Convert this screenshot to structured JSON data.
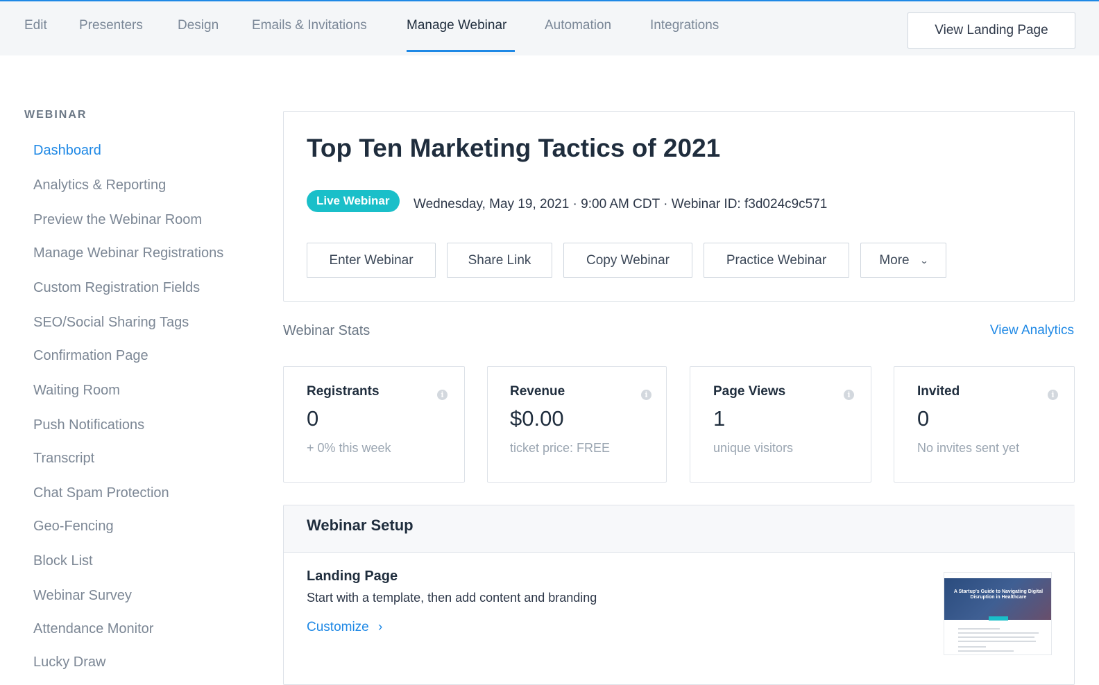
{
  "topnav": {
    "tabs": [
      {
        "label": "Edit"
      },
      {
        "label": "Presenters"
      },
      {
        "label": "Design"
      },
      {
        "label": "Emails & Invitations"
      },
      {
        "label": "Manage Webinar",
        "active": true
      },
      {
        "label": "Automation"
      },
      {
        "label": "Integrations"
      }
    ],
    "view_landing_label": "View Landing Page"
  },
  "sidebar": {
    "heading": "WEBINAR",
    "items": [
      {
        "label": "Dashboard",
        "active": true
      },
      {
        "label": "Analytics & Reporting"
      },
      {
        "label": "Preview the Webinar Room"
      },
      {
        "label": "Manage Webinar Registrations"
      },
      {
        "label": "Custom Registration Fields"
      },
      {
        "label": "SEO/Social Sharing Tags"
      },
      {
        "label": "Confirmation Page"
      },
      {
        "label": "Waiting Room"
      },
      {
        "label": "Push Notifications"
      },
      {
        "label": "Transcript"
      },
      {
        "label": "Chat Spam Protection"
      },
      {
        "label": "Geo-Fencing"
      },
      {
        "label": "Block List"
      },
      {
        "label": "Webinar Survey"
      },
      {
        "label": "Attendance Monitor"
      },
      {
        "label": "Lucky Draw"
      }
    ]
  },
  "webinar": {
    "title": "Top Ten Marketing Tactics of 2021",
    "badge": "Live Webinar",
    "meta": "Wednesday, May 19, 2021 · 9:00 AM CDT · Webinar ID: f3d024c9c571",
    "actions": {
      "enter": "Enter Webinar",
      "share": "Share Link",
      "copy": "Copy Webinar",
      "practice": "Practice Webinar",
      "more": "More"
    }
  },
  "stats": {
    "section_title": "Webinar Stats",
    "view_analytics": "View Analytics",
    "cards": [
      {
        "label": "Registrants",
        "value": "0",
        "sub": "+ 0% this week"
      },
      {
        "label": "Revenue",
        "value": "$0.00",
        "sub": "ticket price: FREE"
      },
      {
        "label": "Page Views",
        "value": "1",
        "sub": "unique visitors"
      },
      {
        "label": "Invited",
        "value": "0",
        "sub": "No invites sent yet"
      }
    ]
  },
  "setup": {
    "title": "Webinar Setup",
    "landing": {
      "title": "Landing Page",
      "desc": "Start with a template, then add content and branding",
      "link": "Customize",
      "thumb_text": "A Startup's Guide to Navigating Digital Disruption in Healthcare"
    }
  },
  "colors": {
    "accent": "#1e88e5",
    "badge": "#1abfc9"
  }
}
